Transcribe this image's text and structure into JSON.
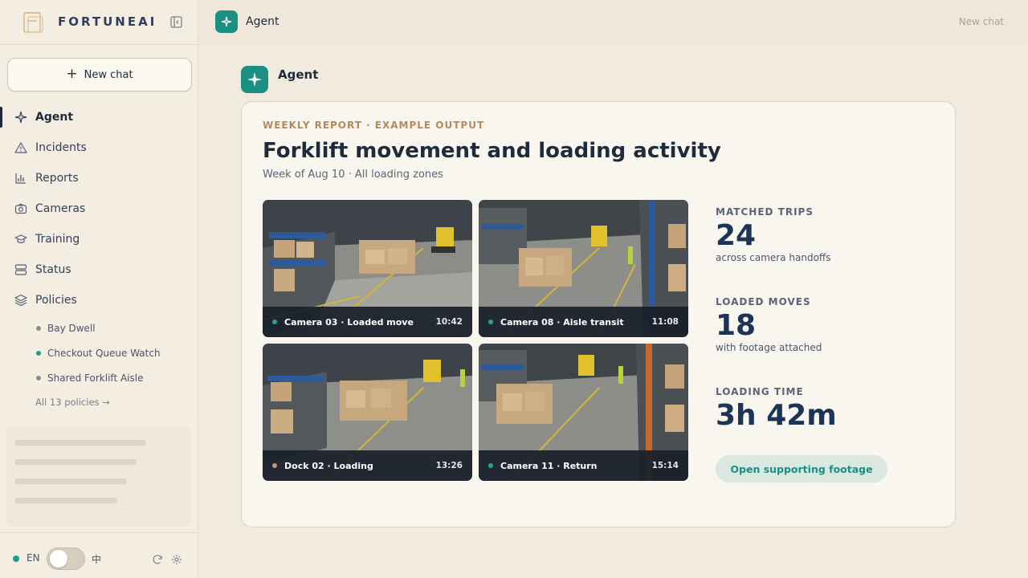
{
  "brand": {
    "name": "FORTUNEAI"
  },
  "sidebar": {
    "new_chat_label": "New chat",
    "nav": [
      {
        "label": "Agent",
        "icon": "sparkle-icon",
        "active": true
      },
      {
        "label": "Incidents",
        "icon": "warning-icon"
      },
      {
        "label": "Reports",
        "icon": "bar-chart-icon"
      },
      {
        "label": "Cameras",
        "icon": "camera-icon"
      },
      {
        "label": "Training",
        "icon": "graduation-cap-icon"
      },
      {
        "label": "Status",
        "icon": "server-icon"
      },
      {
        "label": "Policies",
        "icon": "layers-icon"
      }
    ],
    "policies": [
      {
        "label": "Bay Dwell",
        "color": "#8a8a8a"
      },
      {
        "label": "Checkout Queue Watch",
        "color": "#1a9b8a"
      },
      {
        "label": "Shared Forklift Aisle",
        "color": "#8a8a8a"
      }
    ],
    "all_policies_label": "All 13 policies →"
  },
  "footer": {
    "lang_en": "EN",
    "lang_zh": "中"
  },
  "topbar": {
    "title": "Agent",
    "new_chat_label": "New chat"
  },
  "message": {
    "sender": "Agent"
  },
  "report": {
    "eyebrow": "WEEKLY REPORT · EXAMPLE OUTPUT",
    "title": "Forklift movement and loading activity",
    "subtitle": "Week of Aug 10 · All loading zones",
    "tiles": [
      {
        "label": "Camera 03 · Loaded move",
        "time": "10:42",
        "dot_color": "#27a393"
      },
      {
        "label": "Camera 08 · Aisle transit",
        "time": "11:08",
        "dot_color": "#27a393"
      },
      {
        "label": "Dock 02 · Loading",
        "time": "13:26",
        "dot_color": "#c59a6a"
      },
      {
        "label": "Camera 11 · Return",
        "time": "15:14",
        "dot_color": "#27a393"
      }
    ],
    "stats": [
      {
        "label": "MATCHED TRIPS",
        "value": "24",
        "desc": "across camera handoffs"
      },
      {
        "label": "LOADED MOVES",
        "value": "18",
        "desc": "with footage attached"
      },
      {
        "label": "LOADING TIME",
        "value": "3h 42m",
        "desc": ""
      }
    ],
    "footage_button_label": "Open supporting footage"
  },
  "colors": {
    "accent": "#1b8f82",
    "navy": "#1c3556",
    "eyebrow": "#b58a5a"
  }
}
